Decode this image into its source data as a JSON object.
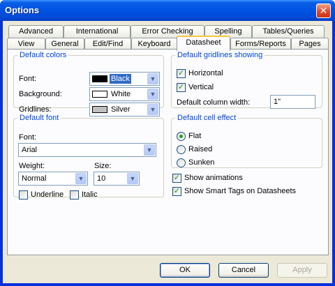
{
  "window": {
    "title": "Options",
    "close_glyph": "✕"
  },
  "tabs_row1": [
    "Advanced",
    "International",
    "Error Checking",
    "Spelling",
    "Tables/Queries"
  ],
  "tabs_row2": [
    "View",
    "General",
    "Edit/Find",
    "Keyboard",
    "Datasheet",
    "Forms/Reports",
    "Pages"
  ],
  "active_tab": "Datasheet",
  "default_colors": {
    "title": "Default colors",
    "font_label": "Font:",
    "font_value": "Black",
    "font_swatch": "#000000",
    "background_label": "Background:",
    "background_value": "White",
    "background_swatch": "#ffffff",
    "gridlines_label": "Gridlines:",
    "gridlines_value": "Silver",
    "gridlines_swatch": "#c0c0c0",
    "selected_highlight": "#316ac5"
  },
  "default_font": {
    "title": "Default font",
    "font_label": "Font:",
    "font_value": "Arial",
    "weight_label": "Weight:",
    "weight_value": "Normal",
    "size_label": "Size:",
    "size_value": "10",
    "underline_label": "Underline",
    "underline_checked": false,
    "italic_label": "Italic",
    "italic_checked": false
  },
  "gridlines": {
    "title": "Default gridlines showing",
    "horizontal_label": "Horizontal",
    "horizontal_checked": true,
    "vertical_label": "Vertical",
    "vertical_checked": true,
    "column_width_label": "Default column width:",
    "column_width_value": "1\""
  },
  "cell_effect": {
    "title": "Default cell effect",
    "options": [
      "Flat",
      "Raised",
      "Sunken"
    ],
    "selected": "Flat"
  },
  "show_animations": {
    "label": "Show animations",
    "checked": true
  },
  "show_smart_tags": {
    "label": "Show Smart Tags on Datasheets",
    "checked": true
  },
  "buttons": {
    "ok": "OK",
    "cancel": "Cancel",
    "apply": "Apply"
  },
  "icons": {
    "dropdown_arrow": "▼",
    "check": "✓"
  }
}
